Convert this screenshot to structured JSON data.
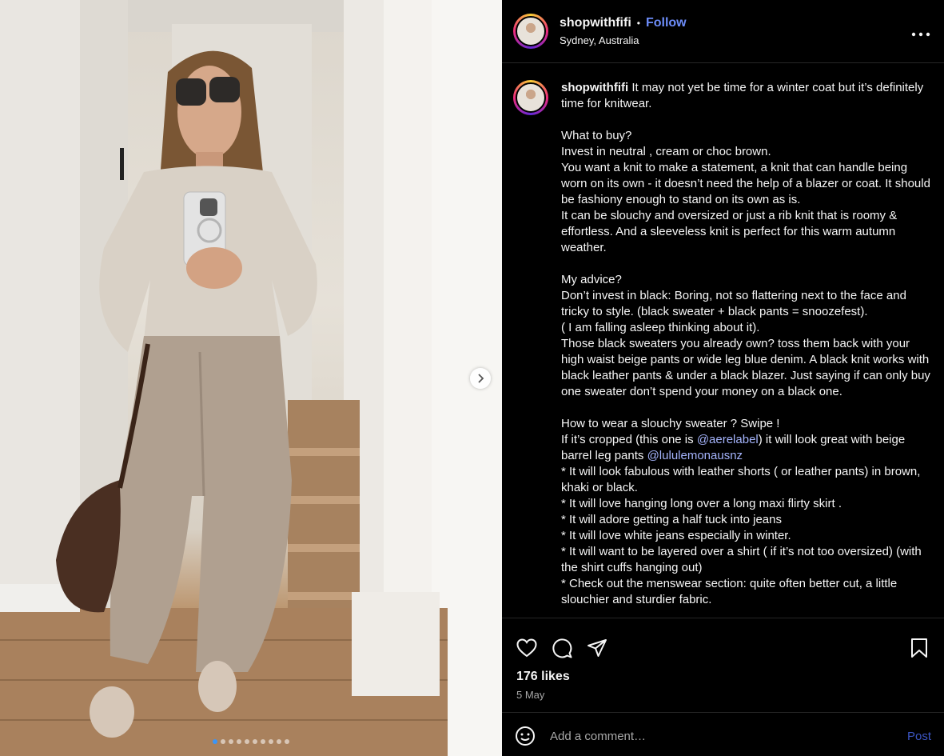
{
  "post": {
    "username": "shopwithfifi",
    "separator": "•",
    "follow_label": "Follow",
    "location": "Sydney, Australia",
    "more_icon": "more-horizontal-icon"
  },
  "caption": {
    "username": "shopwithfifi",
    "lines": [
      {
        "text": " It may not yet be time for a winter coat but it’s definitely time for knitwear."
      },
      {
        "text": ""
      },
      {
        "text": "What to buy?"
      },
      {
        "text": "Invest in neutral , cream or choc brown."
      },
      {
        "text": "You want a knit to make a statement, a knit that can handle being worn on its own - it doesn’t need the help of a blazer or coat. It should be fashiony enough to stand on its own as is."
      },
      {
        "text": "It can be slouchy and oversized or just a rib knit that is roomy & effortless. And a sleeveless knit is perfect for this warm autumn weather."
      },
      {
        "text": ""
      },
      {
        "text": "My advice?"
      },
      {
        "text": "Don’t invest in black: Boring, not so flattering next to the face and tricky to style. (black sweater + black pants = snoozefest)."
      },
      {
        "text": "( I am falling asleep thinking about it)."
      },
      {
        "text": "Those black sweaters you already own? toss them back with your high waist beige pants or wide leg blue denim. A black knit works with black leather pants & under a black blazer. Just saying if can only buy one sweater don’t spend your money on a black one."
      },
      {
        "text": ""
      },
      {
        "text": "How to wear a slouchy sweater ? Swipe !"
      },
      {
        "text": "If it’s cropped (this one is ",
        "mention": "@aerelabel",
        "after": ") it will look great with beige barrel leg pants ",
        "mention2": "@lululemonausnz"
      },
      {
        "text": "* It will look fabulous with leather shorts ( or leather pants) in brown, khaki or black."
      },
      {
        "text": "* It will love hanging long over a long maxi flirty skirt ."
      },
      {
        "text": "* It will adore getting a half tuck into jeans"
      },
      {
        "text": "* It will love white jeans especially in winter."
      },
      {
        "text": "* It will want to be layered over a shirt ( if it’s not too oversized) (with the shirt cuffs hanging out)"
      },
      {
        "text": "* Check out the menswear section: quite often better cut, a little slouchier and sturdier fabric."
      }
    ]
  },
  "actions": {
    "like_icon": "heart-icon",
    "comment_icon": "comment-icon",
    "share_icon": "share-icon",
    "save_icon": "bookmark-icon",
    "likes": "176 likes",
    "date": "5 May"
  },
  "comment": {
    "emoji_icon": "emoji-icon",
    "placeholder": "Add a comment…",
    "post_label": "Post"
  },
  "carousel": {
    "total_slides": 10,
    "active_index": 0,
    "next_icon": "chevron-right-icon"
  },
  "colors": {
    "background": "#000000",
    "follow": "#6d8dfa",
    "mention": "#a5b4fc",
    "post_button": "#4b6cf5",
    "active_dot": "#3b95f6"
  }
}
